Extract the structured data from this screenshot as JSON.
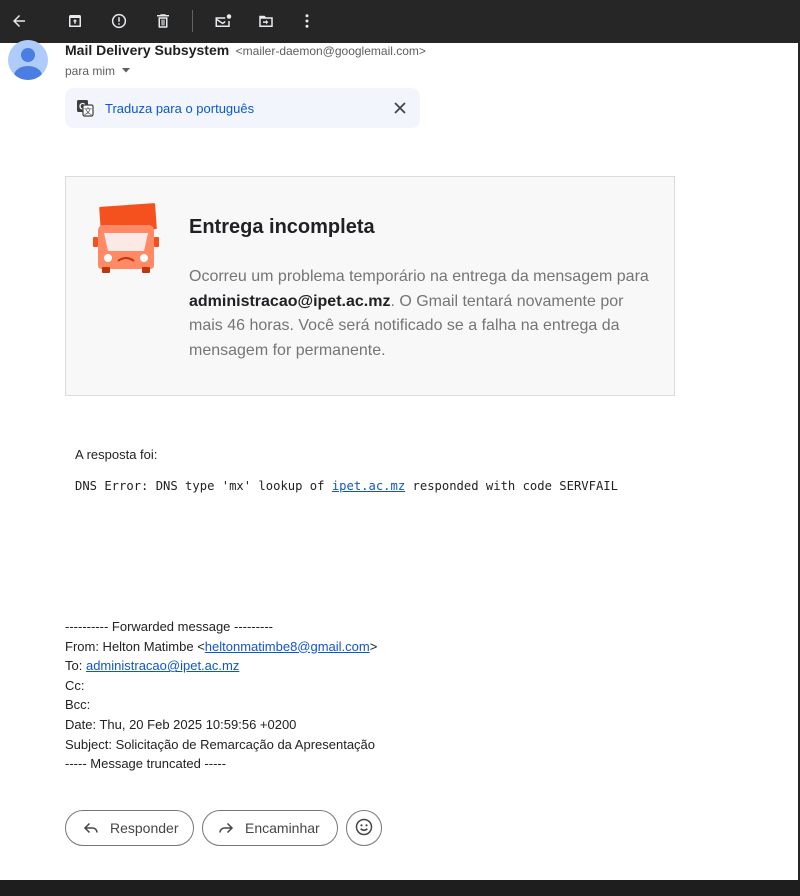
{
  "toolbar": {
    "icons": [
      "back-arrow-icon",
      "archive-icon",
      "report-spam-icon",
      "delete-icon",
      "mark-unread-icon",
      "move-to-icon",
      "more-options-icon"
    ]
  },
  "email": {
    "sender_name": "Mail Delivery Subsystem",
    "sender_email": "<mailer-daemon@googlemail.com>",
    "to": "para mim"
  },
  "translate": {
    "link": "Traduza para o português"
  },
  "delivery_card": {
    "title": "Entrega incompleta",
    "text_before": "Ocorreu um problema temporário na entrega da mensagem para ",
    "address": "administracao@ipet.ac.mz",
    "text_after": ". O Gmail tentará novamente por mais 46 horas. Você será notificado se a falha na entrega da mensagem for permanente."
  },
  "response": {
    "label": "A resposta foi:",
    "code_before": "DNS Error: DNS type 'mx' lookup of ",
    "code_link": "ipet.ac.mz",
    "code_after": " responded with code SERVFAIL"
  },
  "forwarded": {
    "header": "---------- Forwarded message ---------",
    "from_label": "From: Helton Matimbe <",
    "from_email": "heltonmatimbe8@gmail.com",
    "from_close": ">",
    "to_label": "To: ",
    "to_email": "administracao@ipet.ac.mz",
    "cc": "Cc:",
    "bcc": "Bcc:",
    "date": "Date: Thu, 20 Feb 2025 10:59:56 +0200",
    "subject": "Subject: Solicitação de Remarcação da Apresentação",
    "truncated": "----- Message truncated -----"
  },
  "actions": {
    "reply": "Responder",
    "forward": "Encaminhar"
  },
  "colors": {
    "toolbar_bg": "#262626",
    "accent": "#0b57d0",
    "truck": "#f4511e"
  }
}
